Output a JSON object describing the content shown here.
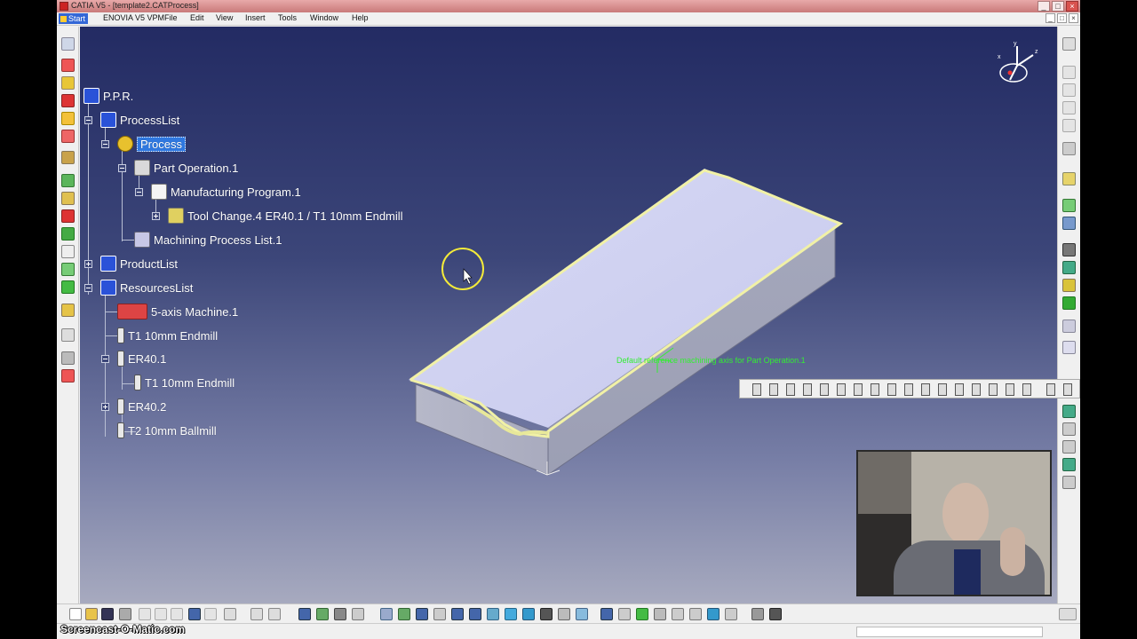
{
  "window": {
    "title": "CATIA V5 - [template2.CATProcess]",
    "controls": [
      "_",
      "□",
      "×"
    ],
    "mdi_controls": [
      "_",
      "□",
      "×"
    ]
  },
  "menu": {
    "start": "Start",
    "items": [
      "ENOVIA V5 VPM",
      "File",
      "Edit",
      "View",
      "Insert",
      "Tools",
      "Window",
      "Help"
    ]
  },
  "tree": {
    "ppr": "P.P.R.",
    "process_list": "ProcessList",
    "process": "Process",
    "part_operation": "Part Operation.1",
    "manufacturing_program": "Manufacturing Program.1",
    "tool_change": "Tool Change.4  ER40.1 / T1 10mm Endmill",
    "machining_process_list": "Machining Process List.1",
    "product_list": "ProductList",
    "resources_list": "ResourcesList",
    "machine": "5-axis Machine.1",
    "tool_t1": "T1 10mm Endmill",
    "er40_1": "ER40.1",
    "er40_1_tool": "T1 10mm Endmill",
    "er40_2": "ER40.2",
    "tool_t2": "T2 10mm Ballmill"
  },
  "viewport": {
    "axis_label": "Default reference machining axis for Part Operation.1",
    "compass_labels": [
      "x",
      "y",
      "z"
    ]
  },
  "watermark": "Screencast-O-Matic.com",
  "colors": {
    "viewport_top": "#232b63",
    "viewport_bottom": "#a7aabf",
    "selection": "#2f78e0",
    "part_top": "#cdd0f0",
    "part_outline": "#f3f3a8",
    "axis_label": "#33ee33"
  }
}
